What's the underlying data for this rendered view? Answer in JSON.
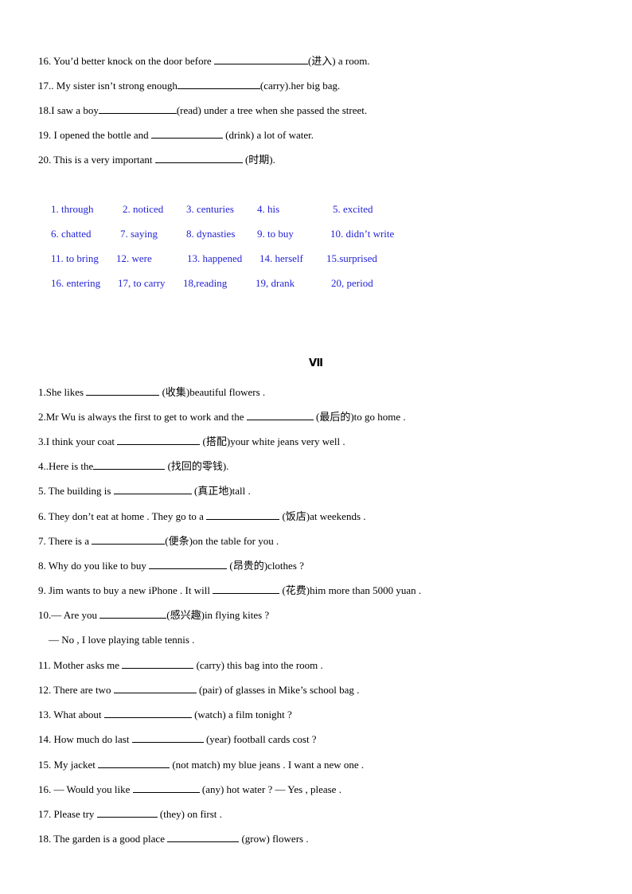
{
  "section_a": {
    "items": [
      {
        "pre": "16. You’d better knock on the door before ",
        "blank": 118,
        "post": "(进入) a room."
      },
      {
        "pre": "17.. My sister isn’t strong enough",
        "blank": 104,
        "post": "(carry).her big bag."
      },
      {
        "pre": "18.I saw a boy",
        "blank": 98,
        "post": "(read) under a tree when she passed the street."
      },
      {
        "pre": "19. I opened the bottle and ",
        "blank": 90,
        "post": " (drink) a lot of water."
      },
      {
        "pre": "20. This is a very important ",
        "blank": 110,
        "post": " (时期)."
      }
    ]
  },
  "answer_key": {
    "color": "#2323d6",
    "rows": [
      [
        "1. through",
        "2. noticed",
        "3. centuries",
        "4. his",
        "5. excited"
      ],
      [
        "6. chatted",
        "7. saying",
        "8. dynasties",
        "9. to buy",
        "10. didn’t write"
      ],
      [
        "11. to bring",
        "12. were",
        "13. happened",
        "14. herself",
        "15.surprised"
      ],
      [
        "16. entering",
        "17, to carry",
        "18,reading",
        "19, drank",
        "20, period"
      ]
    ]
  },
  "section_b": {
    "heading": "Ⅶ",
    "items": [
      {
        "pre": "1.She likes ",
        "blank": 92,
        "post": " (收集)beautiful flowers ."
      },
      {
        "pre": "2.Mr Wu is always the first to get to work and the ",
        "blank": 84,
        "post": " (最后的)to go home ."
      },
      {
        "pre": "3.I think your coat ",
        "blank": 104,
        "post": " (搭配)your white jeans very well ."
      },
      {
        "pre": "4..Here is the",
        "blank": 90,
        "post": " (找回的零钱)."
      },
      {
        "pre": "5. The building is ",
        "blank": 98,
        "post": " (真正地)tall ."
      },
      {
        "pre": "6. They don’t eat at home . They go to a ",
        "blank": 92,
        "post": " (饭店)at weekends ."
      },
      {
        "pre": "7. There is a ",
        "blank": 92,
        "post": "(便条)on the table for you ."
      },
      {
        "pre": "8. Why do you like to buy ",
        "blank": 98,
        "post": " (昂贵的)clothes ?"
      },
      {
        "pre": "9. Jim wants to buy a new iPhone . It will ",
        "blank": 84,
        "post": " (花费)him more than 5000 yuan ."
      },
      {
        "pre": "10.— Are you ",
        "blank": 84,
        "post": "(感兴趣)in flying kites ?"
      },
      {
        "pre": "    — No , I love playing table tennis .",
        "blank": 0,
        "post": ""
      },
      {
        "pre": "11. Mother asks me ",
        "blank": 90,
        "post": " (carry) this bag into the room ."
      },
      {
        "pre": "12. There are two ",
        "blank": 104,
        "post": " (pair) of glasses in Mike’s school bag ."
      },
      {
        "pre": "13. What about ",
        "blank": 110,
        "post": " (watch) a film tonight ?"
      },
      {
        "pre": "14. How much do last ",
        "blank": 90,
        "post": " (year) football cards cost ?"
      },
      {
        "pre": "15. My jacket ",
        "blank": 90,
        "post": " (not match) my blue jeans . I want a new one ."
      },
      {
        "pre": "16. — Would you like ",
        "blank": 84,
        "post": " (any) hot water ? — Yes , please ."
      },
      {
        "pre": "17. Please try ",
        "blank": 76,
        "post": " (they) on first ."
      },
      {
        "pre": "18. The garden is a good place ",
        "blank": 90,
        "post": " (grow) flowers ."
      }
    ]
  }
}
